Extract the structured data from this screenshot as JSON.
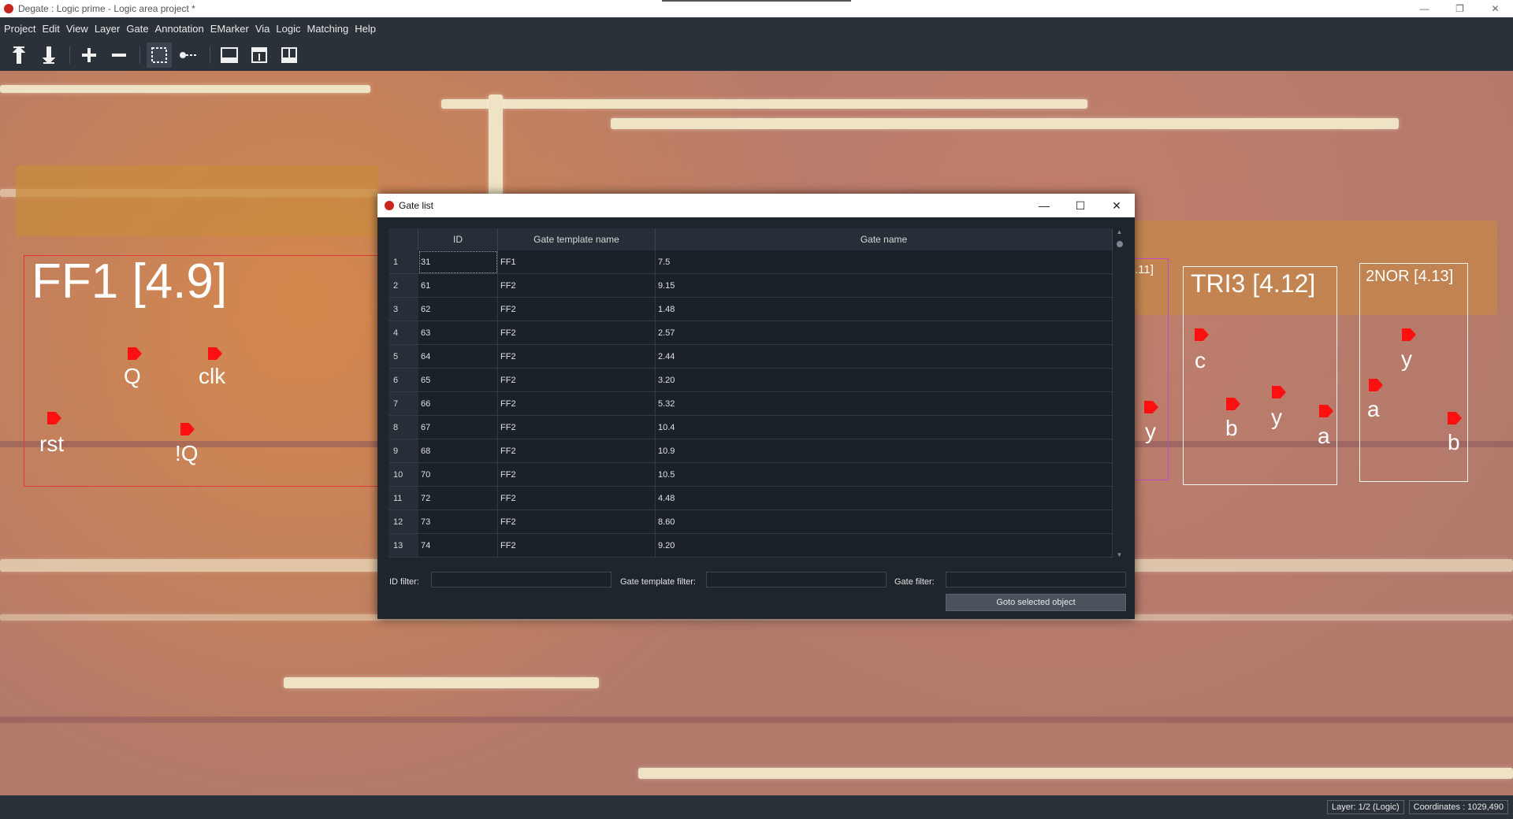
{
  "window": {
    "title": "Degate : Logic prime - Logic area project *",
    "controls": {
      "minimize": "—",
      "maximize": "❐",
      "close": "✕"
    }
  },
  "menu": [
    "Project",
    "Edit",
    "View",
    "Layer",
    "Gate",
    "Annotation",
    "EMarker",
    "Via",
    "Logic",
    "Matching",
    "Help"
  ],
  "toolbar": {
    "icons": [
      "layer-up-icon",
      "layer-down-icon",
      "zoom-in-icon",
      "zoom-out-icon",
      "area-select-icon",
      "wire-tool-icon",
      "view-icon-1",
      "view-icon-2",
      "view-icon-3"
    ]
  },
  "canvas": {
    "gates": {
      "ff1": {
        "title": "FF1 [4.9]",
        "pins": {
          "q": "Q",
          "clk": "clk",
          "rst": "rst",
          "nq": "!Q"
        }
      },
      "partial": {
        "title": ".11]",
        "pins": {
          "y": "y"
        }
      },
      "tri3": {
        "title": "TRI3 [4.12]",
        "pins": {
          "c": "c",
          "b": "b",
          "y": "y",
          "a": "a"
        }
      },
      "nor2": {
        "title": "2NOR [4.13]",
        "pins": {
          "y": "y",
          "a": "a",
          "b": "b"
        }
      }
    }
  },
  "status": {
    "layer": "Layer: 1/2 (Logic)",
    "coordinates": "Coordinates : 1029,490"
  },
  "dialog": {
    "title": "Gate list",
    "controls": {
      "minimize": "—",
      "maximize": "☐",
      "close": "✕"
    },
    "columns": {
      "id": "ID",
      "template": "Gate template name",
      "name": "Gate name"
    },
    "rows": [
      {
        "n": "1",
        "id": "31",
        "template": "FF1",
        "name": "7.5"
      },
      {
        "n": "2",
        "id": "61",
        "template": "FF2",
        "name": "9.15"
      },
      {
        "n": "3",
        "id": "62",
        "template": "FF2",
        "name": "1.48"
      },
      {
        "n": "4",
        "id": "63",
        "template": "FF2",
        "name": "2.57"
      },
      {
        "n": "5",
        "id": "64",
        "template": "FF2",
        "name": "2.44"
      },
      {
        "n": "6",
        "id": "65",
        "template": "FF2",
        "name": "3.20"
      },
      {
        "n": "7",
        "id": "66",
        "template": "FF2",
        "name": "5.32"
      },
      {
        "n": "8",
        "id": "67",
        "template": "FF2",
        "name": "10.4"
      },
      {
        "n": "9",
        "id": "68",
        "template": "FF2",
        "name": "10.9"
      },
      {
        "n": "10",
        "id": "70",
        "template": "FF2",
        "name": "10.5"
      },
      {
        "n": "11",
        "id": "72",
        "template": "FF2",
        "name": "4.48"
      },
      {
        "n": "12",
        "id": "73",
        "template": "FF2",
        "name": "8.60"
      },
      {
        "n": "13",
        "id": "74",
        "template": "FF2",
        "name": "9.20"
      }
    ],
    "filters": {
      "id_label": "ID filter:",
      "template_label": "Gate template filter:",
      "name_label": "Gate filter:",
      "id_value": "",
      "template_value": "",
      "name_value": ""
    },
    "goto_label": "Goto selected object"
  },
  "colors": {
    "pin": "#ff1010",
    "gate_border": "#e03a3a",
    "ui_bg": "#2b3138",
    "dialog_bg": "#1e252d"
  }
}
